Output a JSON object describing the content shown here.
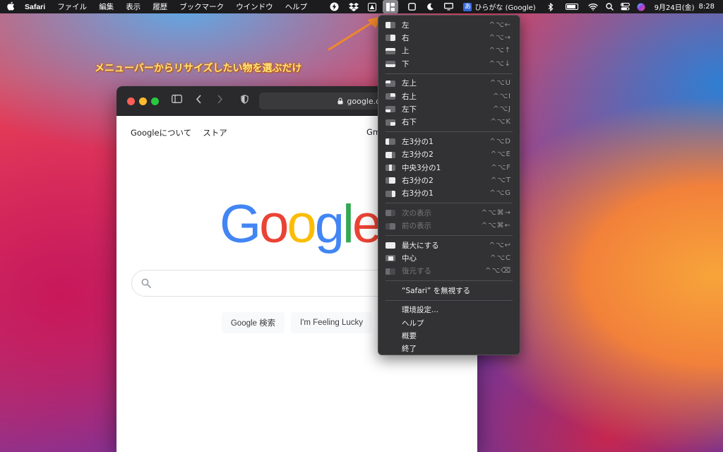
{
  "menubar": {
    "apple": "",
    "app_name": "Safari",
    "items": [
      "ファイル",
      "編集",
      "表示",
      "履歴",
      "ブックマーク",
      "ウインドウ",
      "ヘルプ"
    ],
    "status": {
      "input_method_char": "あ",
      "input_method": "ひらがな (Google)",
      "date": "9月24日(金)",
      "time": "8:28"
    }
  },
  "annotation": "メニューバーからリサイズしたい物を選ぶだけ",
  "safari": {
    "url": "google.com",
    "top_links": [
      "Googleについて",
      "ストア"
    ],
    "gmail_partial": "Gm",
    "logo": [
      "G",
      "o",
      "o",
      "g",
      "l",
      "e"
    ],
    "logo_colors": [
      "#4285f4",
      "#ea4335",
      "#fbbc05",
      "#4285f4",
      "#34a853",
      "#ea4335"
    ],
    "search_button": "Google 検索",
    "lucky_button": "I'm Feeling Lucky"
  },
  "menu": {
    "groups": [
      [
        {
          "label": "左",
          "shortcut": "^⌥←",
          "icon": "left-half"
        },
        {
          "label": "右",
          "shortcut": "^⌥→",
          "icon": "right-half"
        },
        {
          "label": "上",
          "shortcut": "^⌥↑",
          "icon": "top-half"
        },
        {
          "label": "下",
          "shortcut": "^⌥↓",
          "icon": "bottom-half"
        }
      ],
      [
        {
          "label": "左上",
          "shortcut": "^⌥U",
          "icon": "top-left"
        },
        {
          "label": "右上",
          "shortcut": "^⌥I",
          "icon": "top-right"
        },
        {
          "label": "左下",
          "shortcut": "^⌥J",
          "icon": "bottom-left"
        },
        {
          "label": "右下",
          "shortcut": "^⌥K",
          "icon": "bottom-right"
        }
      ],
      [
        {
          "label": "左3分の1",
          "shortcut": "^⌥D",
          "icon": "first-third"
        },
        {
          "label": "左3分の2",
          "shortcut": "^⌥E",
          "icon": "first-two-thirds"
        },
        {
          "label": "中央3分の1",
          "shortcut": "^⌥F",
          "icon": "center-third"
        },
        {
          "label": "右3分の2",
          "shortcut": "^⌥T",
          "icon": "last-two-thirds"
        },
        {
          "label": "右3分の1",
          "shortcut": "^⌥G",
          "icon": "last-third"
        }
      ],
      [
        {
          "label": "次の表示",
          "shortcut": "^⌥⌘→",
          "icon": "next-display",
          "disabled": true
        },
        {
          "label": "前の表示",
          "shortcut": "^⌥⌘←",
          "icon": "previous-display",
          "disabled": true
        }
      ],
      [
        {
          "label": "最大にする",
          "shortcut": "^⌥↩",
          "icon": "maximize"
        },
        {
          "label": "中心",
          "shortcut": "^⌥C",
          "icon": "center"
        },
        {
          "label": "復元する",
          "shortcut": "^⌥⌫",
          "icon": "restore",
          "disabled": true
        }
      ],
      [
        {
          "label": "“Safari” を無視する",
          "shortcut": "",
          "icon": ""
        }
      ],
      [
        {
          "label": "環境設定...",
          "shortcut": "",
          "icon": ""
        },
        {
          "label": "ヘルプ",
          "shortcut": "",
          "icon": ""
        },
        {
          "label": "概要",
          "shortcut": "",
          "icon": ""
        },
        {
          "label": "終了",
          "shortcut": "",
          "icon": ""
        }
      ]
    ]
  },
  "colors": {
    "accent_annotation": "#ffe87a",
    "arrow": "#f0882a",
    "menu_bg": "#323234"
  }
}
